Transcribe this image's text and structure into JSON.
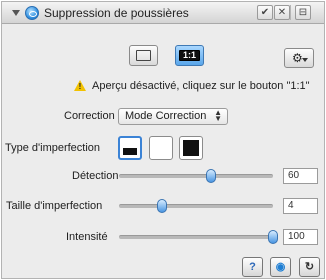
{
  "header": {
    "title": "Suppression de poussières",
    "check_icon": "check-icon",
    "close_icon": "close-icon",
    "menu_icon": "panel-menu-icon"
  },
  "preview": {
    "fit_icon": "fit-preview-icon",
    "actual_label": "1:1",
    "gear_icon": "gear-icon"
  },
  "notice": {
    "icon": "warning-icon",
    "text": "Aperçu désactivé, cliquez sur le bouton \"1:1\""
  },
  "correction": {
    "label": "Correction",
    "selected": "Mode Correction"
  },
  "imperfection_type": {
    "label": "Type d'imperfection",
    "options": [
      "dark-bottom-swatch",
      "white-swatch",
      "black-swatch"
    ],
    "selected_index": 0
  },
  "sliders": [
    {
      "label": "Détection",
      "value": "60",
      "fraction": 0.6
    },
    {
      "label": "Taille d'imperfection",
      "value": "4",
      "fraction": 0.28
    },
    {
      "label": "Intensité",
      "value": "100",
      "fraction": 1.0
    }
  ],
  "footer": {
    "help_icon": "help-icon",
    "preview_icon": "preview-icon",
    "reset_icon": "reset-icon"
  },
  "colors": {
    "accent": "#3b83d6",
    "warning": "#f2c200"
  }
}
